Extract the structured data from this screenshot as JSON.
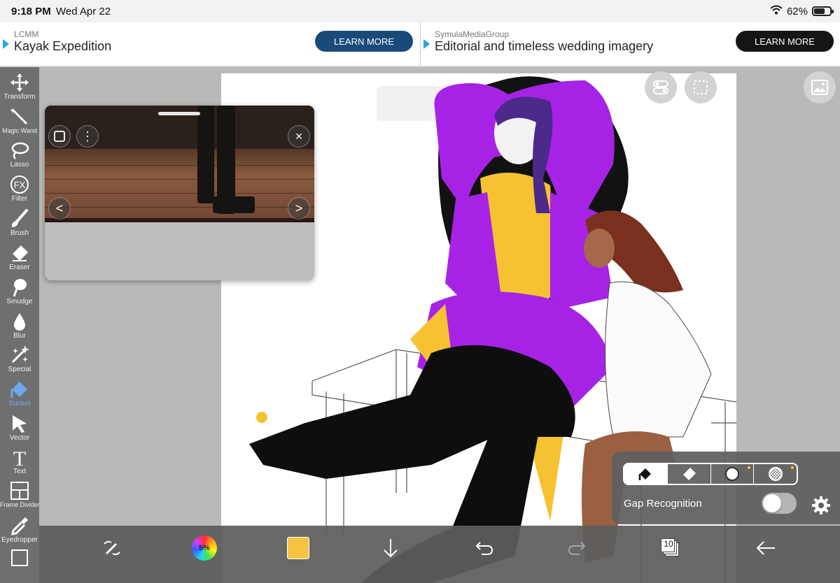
{
  "status_bar": {
    "time": "9:18 PM",
    "date": "Wed Apr 22",
    "battery_text": "62%",
    "battery_level": 0.62,
    "icons": [
      "wifi-icon",
      "battery-icon"
    ]
  },
  "ads": [
    {
      "sponsor": "LCMM",
      "headline": "Kayak Expedition",
      "cta": "LEARN MORE",
      "cta_color": "#1a4a7a"
    },
    {
      "sponsor": "SymulaMediaGroup",
      "headline": "Editorial and timeless wedding imagery",
      "cta": "LEARN MORE",
      "cta_color": "#151515"
    }
  ],
  "toolbar": {
    "active_tool": "Bucket",
    "active_color": "#6fa8ea",
    "tools": [
      {
        "label": "Transform",
        "icon": "transform-arrows-icon"
      },
      {
        "label": "Magic Wand",
        "icon": "magic-wand-icon"
      },
      {
        "label": "Lasso",
        "icon": "lasso-icon"
      },
      {
        "label": "Filter",
        "icon": "fx-filter-icon"
      },
      {
        "label": "Brush",
        "icon": "brush-icon"
      },
      {
        "label": "Eraser",
        "icon": "eraser-icon"
      },
      {
        "label": "Smudge",
        "icon": "smudge-icon"
      },
      {
        "label": "Blur",
        "icon": "blur-drop-icon"
      },
      {
        "label": "Special",
        "icon": "sparkle-icon"
      },
      {
        "label": "Bucket",
        "icon": "bucket-icon"
      },
      {
        "label": "Vector",
        "icon": "vector-pointer-icon"
      },
      {
        "label": "Text",
        "icon": "text-icon"
      },
      {
        "label": "Frame Divider",
        "icon": "frame-divider-icon"
      },
      {
        "label": "Eyedropper",
        "icon": "eyedropper-icon"
      },
      {
        "label": "",
        "icon": "canvas-icon"
      }
    ],
    "filter_glyph": "FX",
    "text_glyph": "T"
  },
  "canvas": {
    "icons": [
      "toggle-panel-icon",
      "selection-icon",
      "reference-image-icon"
    ]
  },
  "reference_panel": {
    "icons": [
      "window-icon",
      "more-vertical-icon",
      "close-icon",
      "chevron-left-icon",
      "chevron-right-icon"
    ],
    "prev_glyph": "<",
    "next_glyph": ">",
    "close_glyph": "×",
    "more_glyph": "⋮"
  },
  "bottom_bar": {
    "color_wheel_text": "5%",
    "current_color": "#f6c343",
    "layer_count": "10",
    "icons": [
      "pen-stabilizer-icon",
      "color-wheel-icon",
      "color-swatch-icon",
      "download-arrow-icon",
      "undo-icon",
      "redo-icon",
      "layers-icon",
      "back-arrow-icon"
    ]
  },
  "fill_panel": {
    "modes": [
      {
        "name": "bucket-mode",
        "selected": true
      },
      {
        "name": "eraser-mode",
        "selected": false
      },
      {
        "name": "circle-mode",
        "selected": false
      },
      {
        "name": "transparent-mode",
        "selected": false
      }
    ],
    "gap_label": "Gap Recognition",
    "gap_enabled": false
  }
}
